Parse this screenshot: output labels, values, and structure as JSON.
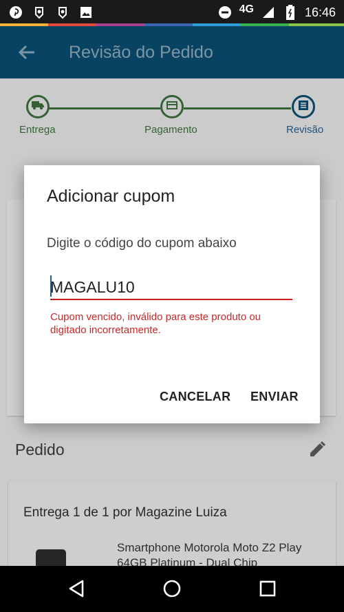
{
  "status_bar": {
    "network": "4G",
    "time": "16:46",
    "left_icons": [
      "pinterest-icon",
      "hand-notification-icon",
      "hand-notification-icon",
      "image-icon"
    ],
    "right_icons": [
      "do-not-disturb-icon",
      "signal-icon",
      "battery-icon"
    ]
  },
  "app_bar": {
    "title": "Revisão do Pedido",
    "back_icon": "arrow-back-icon"
  },
  "stepper": {
    "steps": [
      {
        "label": "Entrega",
        "icon": "truck-icon"
      },
      {
        "label": "Pagamento",
        "icon": "card-icon"
      },
      {
        "label": "Revisão",
        "icon": "list-icon"
      }
    ],
    "colors": {
      "completed": "#3d6d3a",
      "active": "#255c8a"
    }
  },
  "background": {
    "pedido_title": "Pedido",
    "entrega_text": "Entrega 1 de 1 por Magazine Luiza",
    "product_text": "Smartphone Motorola Moto Z2 Play 64GB Platinum - Dual Chip"
  },
  "dialog": {
    "title": "Adicionar cupom",
    "message": "Digite o código do cupom abaixo",
    "input_value": "MAGALU10",
    "error": "Cupom vencido, inválido para este produto ou digitado incorretamente.",
    "cancel_label": "CANCELAR",
    "submit_label": "ENVIAR",
    "error_color": "#c62828"
  },
  "nav_bar": {
    "icons": [
      "back-triangle-icon",
      "home-circle-icon",
      "recents-square-icon"
    ]
  }
}
